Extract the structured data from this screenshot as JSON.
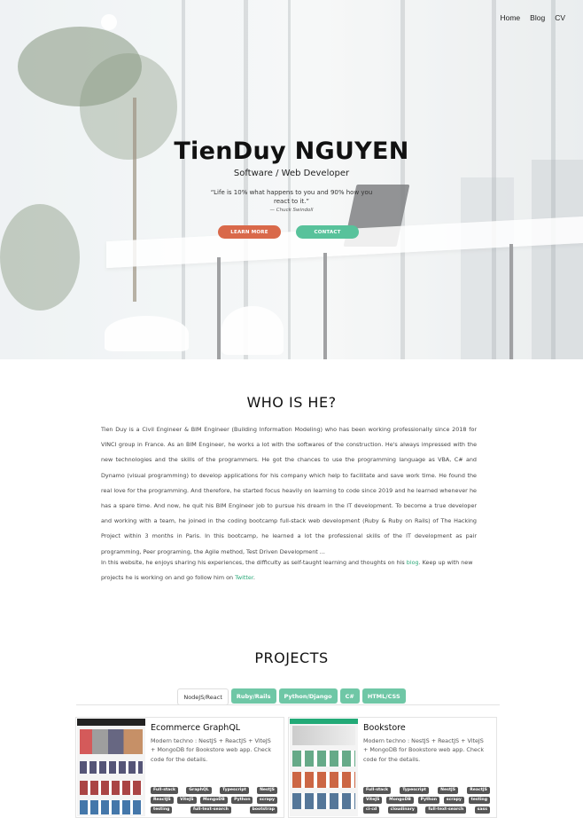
{
  "nav": {
    "items": [
      "Home",
      "Blog",
      "CV"
    ]
  },
  "hero": {
    "name": "TienDuy NGUYEN",
    "role": "Software / Web Developer",
    "quote": "“Life is 10% what happens to you and 90% how you react to it.”",
    "quote_author": "— Chuck Swindoll",
    "learn_more": "LEARN MORE",
    "contact": "CONTACT"
  },
  "about": {
    "title": "WHO IS HE?",
    "paragraph1": "Tien Duy is a Civil Engineer & BIM Engineer (Building Information Modeling) who has been working professionally since 2018 for VINCI group in France. As an BIM Engineer, he works a lot with the softwares of the construction. He's always impressed with the new technologies and the skills of the programmers. He got the chances to use the programming language as VBA, C# and Dynamo (visual programming) to develop applications for his company which help to facilitate and save work time. He found the real love for the programming. And therefore, he started focus heavily on learning to code since 2019 and he learned whenever he has a spare time. And now, he quit his BIM Engineer job to pursue his dream in the IT development. To become a true developer and working with a team, he joined in the coding bootcamp full-stack web development (Ruby & Ruby on Rails) of The Hacking Project within 3 months in Paris. In this bootcamp, he learned a lot the professional skills of the IT development as pair programming, Peer programing, the Agile method, Test Driven Development ...",
    "p2_before_blog": "In this website, he enjoys sharing his experiences, the difficulty as self-taught learning and thoughts on his ",
    "blog_link": "blog",
    "p2_middle": ". Keep up with new projects he is working on and go follow him on ",
    "twitter_link": "Twitter",
    "p2_end": "."
  },
  "projects": {
    "title": "PROJECTS",
    "tabs": [
      "NodeJS/React",
      "Ruby/Rails",
      "Python/Django",
      "C#",
      "HTML/CSS"
    ],
    "active_tab": "NodeJS/React",
    "cards": [
      {
        "title": "Ecommerce GraphQL",
        "description": "Modern techno : NestJS + ReactJS + ViteJS + MongoDB for Bookstore web app. Check code for the details.",
        "tags": [
          "Full-stack",
          "GraphQL",
          "Typescript",
          "NestJS",
          "ReactJS",
          "ViteJS",
          "MongoDB",
          "Python",
          "scrapy",
          "testing",
          "full-text-search",
          "bootstrap"
        ]
      },
      {
        "title": "Bookstore",
        "description": "Modern techno : NestJS + ReactJS + ViteJS + MongoDB for Bookstore web app. Check code for the details.",
        "tags": [
          "Full-stack",
          "Typescript",
          "NestJS",
          "ReactJS",
          "ViteJS",
          "MongoDB",
          "Python",
          "scrapy",
          "testing",
          "ci-cd",
          "cloudinary",
          "full-text-search",
          "sass"
        ]
      }
    ]
  },
  "colors": {
    "accent_green": "#58c29b",
    "accent_orange": "#d9694a",
    "tag_bg": "#555555",
    "link": "#2aa878"
  }
}
